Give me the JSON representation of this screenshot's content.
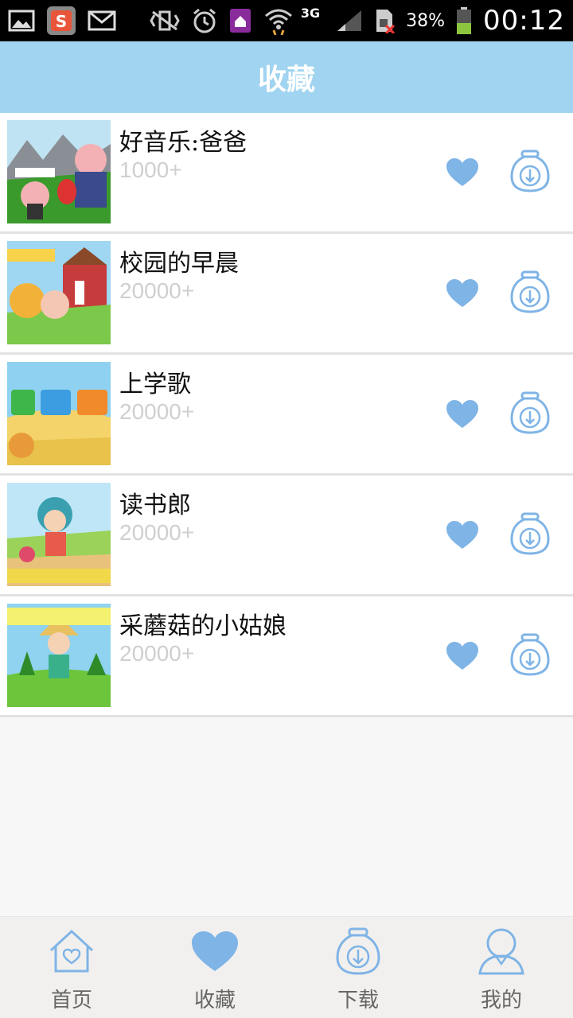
{
  "status_bar": {
    "battery": "38%",
    "time": "00:12",
    "network": "3G"
  },
  "header": {
    "title": "收藏"
  },
  "items": [
    {
      "title": "好音乐:爸爸",
      "count": "1000+"
    },
    {
      "title": "校园的早晨",
      "count": "20000+"
    },
    {
      "title": "上学歌",
      "count": "20000+"
    },
    {
      "title": "读书郎",
      "count": "20000+"
    },
    {
      "title": "采蘑菇的小姑娘",
      "count": "20000+"
    }
  ],
  "nav": {
    "home": "首页",
    "favorites": "收藏",
    "download": "下载",
    "mine": "我的"
  },
  "colors": {
    "accent": "#7fb4e6",
    "header_bg": "#a0d4f0",
    "count_text": "#cfcfcf"
  },
  "icons": {
    "favorite": "heart-icon",
    "download": "download-bag-icon",
    "home": "home-icon",
    "mine": "user-icon"
  }
}
